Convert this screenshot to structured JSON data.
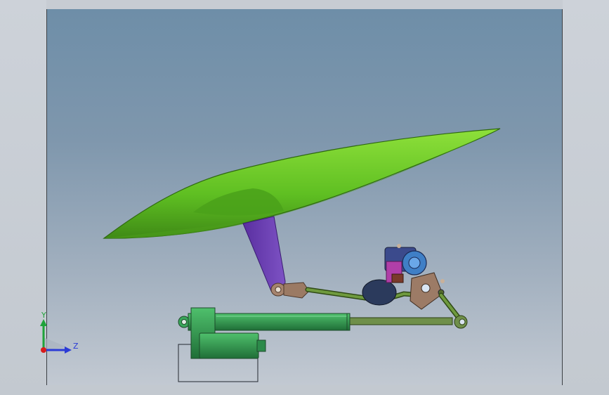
{
  "triad": {
    "y_label": "Y",
    "z_label": "Z"
  },
  "colors": {
    "viewport_top": "#6e8ea8",
    "viewport_bottom": "#c2c9d2",
    "wing": "#6fcf2a",
    "wing_dark": "#3f8a16",
    "strut": "#6a3fb0",
    "actuator": "#2f9b4f",
    "linkage": "#5f8a3a",
    "axis_x": "#d81b1b",
    "axis_y": "#1fa33a",
    "axis_z": "#2b3bd6"
  }
}
